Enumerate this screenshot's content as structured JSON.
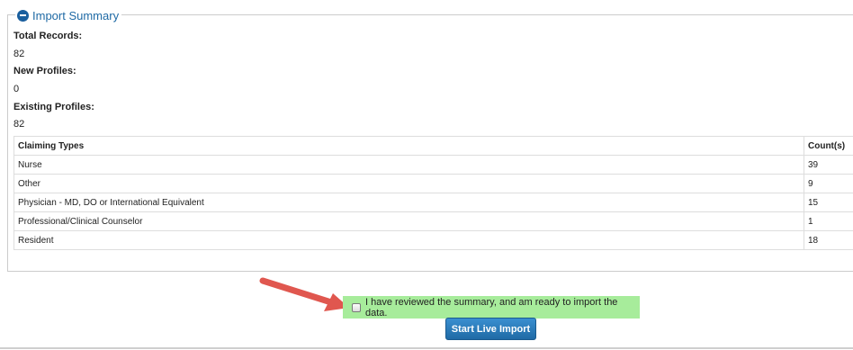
{
  "import_summary": {
    "legend": "Import Summary",
    "total_records_label": "Total Records:",
    "total_records_value": "82",
    "new_profiles_label": "New Profiles:",
    "new_profiles_value": "0",
    "existing_profiles_label": "Existing Profiles:",
    "existing_profiles_value": "82",
    "table": {
      "headers": [
        "Claiming Types",
        "Count(s)"
      ],
      "rows": [
        {
          "type": "Nurse",
          "count": "39"
        },
        {
          "type": "Other",
          "count": "9"
        },
        {
          "type": "Physician - MD, DO or International Equivalent",
          "count": "15"
        },
        {
          "type": "Professional/Clinical Counselor",
          "count": "1"
        },
        {
          "type": "Resident",
          "count": "18"
        }
      ]
    }
  },
  "confirm": {
    "checked": false,
    "label": "I have reviewed the summary, and am ready to import the data."
  },
  "start_button": {
    "label": "Start Live Import"
  },
  "icons": {
    "legend_icon": "minus-circle-icon",
    "annotation": "arrow-icon"
  },
  "colors": {
    "accent": "#1f6aa5",
    "highlight": "#a7ec9b",
    "arrow": "#e0574f"
  }
}
